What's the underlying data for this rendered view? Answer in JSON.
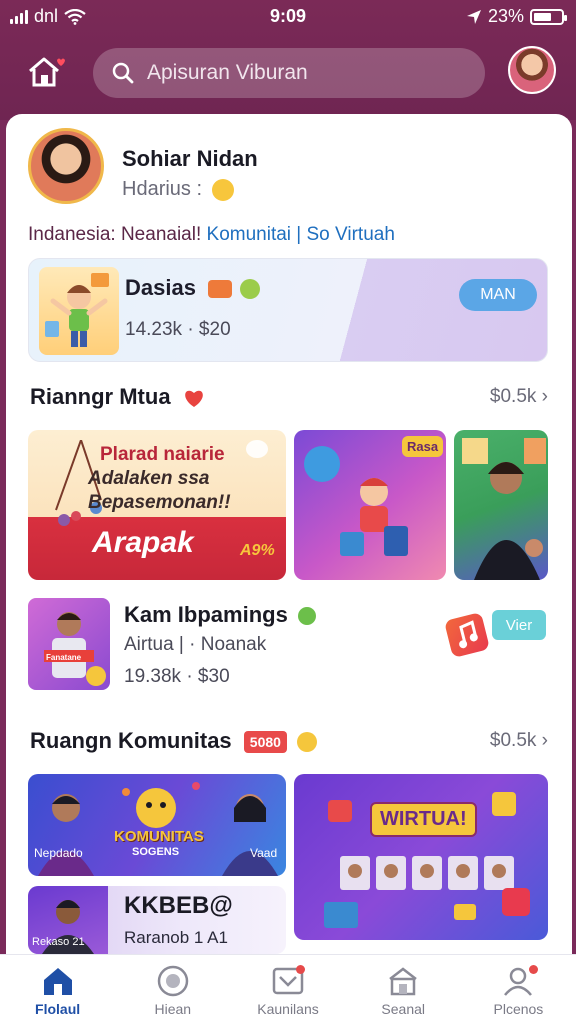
{
  "status_bar": {
    "carrier": "dnl",
    "time": "9:09",
    "battery": "23%"
  },
  "header": {
    "search_placeholder": "Apisuran Viburan"
  },
  "profile": {
    "name": "Sohiar Nidan",
    "subtitle": "Hdarius :",
    "tagline_a": "Indanesia: Neanaial!",
    "tagline_b": "Komunitai | So Virtuah"
  },
  "feature_banner": {
    "title": "Dasias",
    "meta": "14.23k · $20",
    "button_label": "MAN"
  },
  "section_1": {
    "title": "Rianngr Mtua",
    "more": "$0.5k",
    "tiles": [
      {
        "line1": "Plarad naiarie",
        "line2": "Adalaken ssa",
        "line3": "Bepasemonan!!",
        "big": "Arapak",
        "tag": "A9%"
      },
      {
        "badge": "Rasa"
      },
      {}
    ]
  },
  "video_item": {
    "title": "Kam Ibpamings",
    "subtitle": "Airtua | · Noanak",
    "meta": "19.38k · $30",
    "button_label": "Vier",
    "thumb_label": "Fanatane"
  },
  "section_2": {
    "title": "Ruangn Komunitas",
    "badge": "5080",
    "more": "$0.5k",
    "tiles": [
      {
        "label": "KOMUNITAS",
        "sub": "SOGENS",
        "left_name": "Nepdado",
        "right_name": "Vaad"
      },
      {
        "banner": "WIRTUA!"
      },
      {
        "title": "KKBEB@",
        "sub": "Raranob 1 A1",
        "caption": "Rekaso 21"
      }
    ]
  },
  "bottom_nav": [
    {
      "label": "Flolaul",
      "icon": "home-icon"
    },
    {
      "label": "Hiean",
      "icon": "explore-icon"
    },
    {
      "label": "Kaunilans",
      "icon": "chat-icon"
    },
    {
      "label": "Seanal",
      "icon": "store-icon"
    },
    {
      "label": "Plcenos",
      "icon": "profile-icon"
    }
  ],
  "colors": {
    "header_bg": "#7b2a57",
    "accent_blue": "#1f4fa6",
    "link_blue": "#1f6fbf"
  }
}
